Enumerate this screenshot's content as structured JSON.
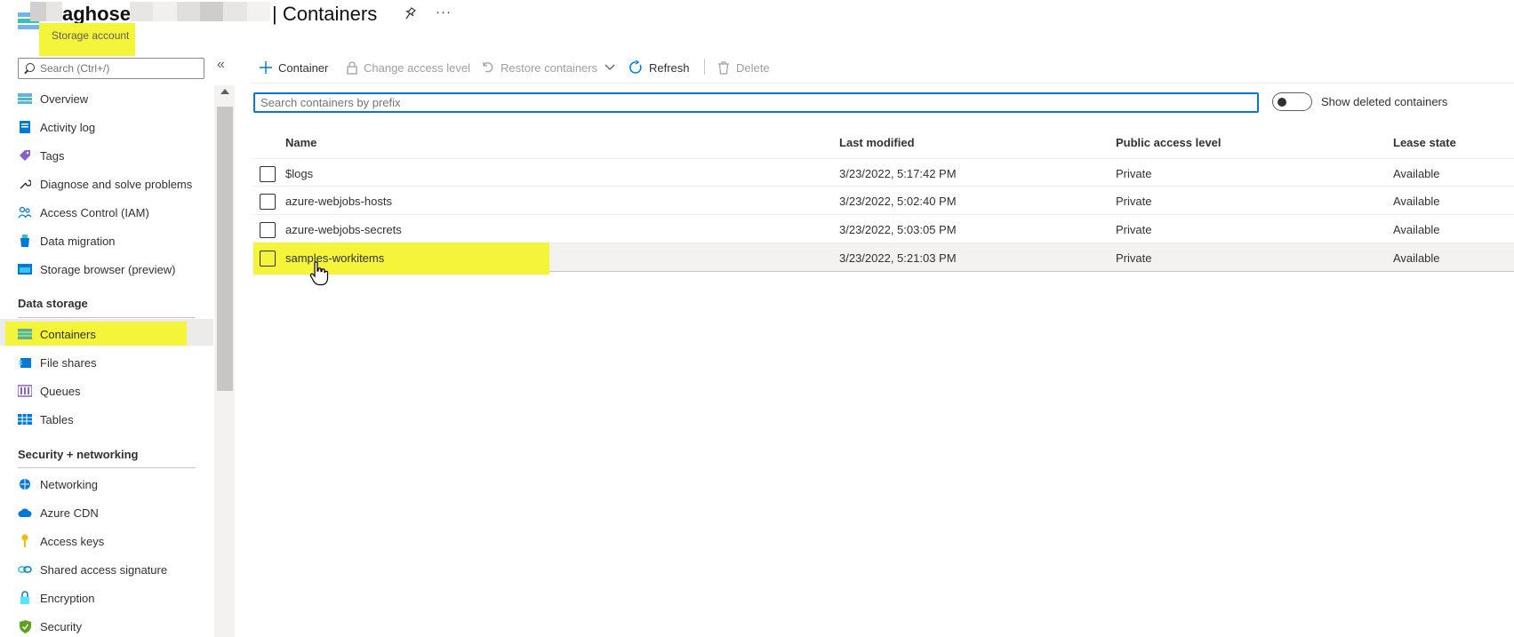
{
  "header": {
    "name_visible": "aghose",
    "title_suffix": "| Containers",
    "subtitle": "Storage account",
    "pin_icon": "pin-icon",
    "more_icon": "ellipsis-icon"
  },
  "sidebar": {
    "search_placeholder": "Search (Ctrl+/)",
    "collapse_glyph": "«",
    "items_top": [
      {
        "label": "Overview",
        "icon": "overview-icon"
      },
      {
        "label": "Activity log",
        "icon": "activity-log-icon"
      },
      {
        "label": "Tags",
        "icon": "tag-icon"
      },
      {
        "label": "Diagnose and solve problems",
        "icon": "wrench-icon"
      },
      {
        "label": "Access Control (IAM)",
        "icon": "people-icon"
      },
      {
        "label": "Data migration",
        "icon": "migration-icon"
      },
      {
        "label": "Storage browser (preview)",
        "icon": "storage-browser-icon"
      }
    ],
    "section_data_storage": "Data storage",
    "items_data_storage": [
      {
        "label": "Containers",
        "icon": "containers-icon",
        "active": true
      },
      {
        "label": "File shares",
        "icon": "file-shares-icon"
      },
      {
        "label": "Queues",
        "icon": "queues-icon"
      },
      {
        "label": "Tables",
        "icon": "tables-icon"
      }
    ],
    "section_security": "Security + networking",
    "items_security": [
      {
        "label": "Networking",
        "icon": "networking-icon"
      },
      {
        "label": "Azure CDN",
        "icon": "cloud-icon"
      },
      {
        "label": "Access keys",
        "icon": "key-icon"
      },
      {
        "label": "Shared access signature",
        "icon": "link-icon"
      },
      {
        "label": "Encryption",
        "icon": "lock-icon"
      },
      {
        "label": "Security",
        "icon": "shield-icon"
      }
    ]
  },
  "toolbar": {
    "container": "Container",
    "change_access": "Change access level",
    "restore": "Restore containers",
    "refresh": "Refresh",
    "delete": "Delete"
  },
  "filter": {
    "placeholder": "Search containers by prefix",
    "toggle_label": "Show deleted containers"
  },
  "table": {
    "headers": {
      "name": "Name",
      "modified": "Last modified",
      "access": "Public access level",
      "lease": "Lease state"
    },
    "rows": [
      {
        "name": "$logs",
        "modified": "3/23/2022, 5:17:42 PM",
        "access": "Private",
        "lease": "Available"
      },
      {
        "name": "azure-webjobs-hosts",
        "modified": "3/23/2022, 5:02:40 PM",
        "access": "Private",
        "lease": "Available"
      },
      {
        "name": "azure-webjobs-secrets",
        "modified": "3/23/2022, 5:03:05 PM",
        "access": "Private",
        "lease": "Available"
      },
      {
        "name": "samples-workitems",
        "modified": "3/23/2022, 5:21:03 PM",
        "access": "Private",
        "lease": "Available"
      }
    ]
  },
  "colors": {
    "accent": "#0078d4",
    "highlight": "#f4f43b"
  }
}
